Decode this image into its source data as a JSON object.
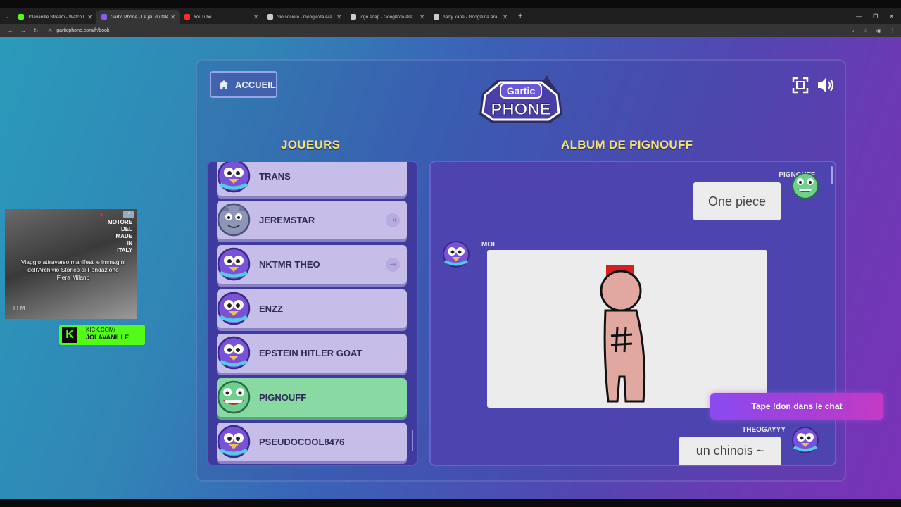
{
  "browser": {
    "tabs": [
      {
        "title": "Jolavanille Stream - Watch Live",
        "color": "#53fc18",
        "active": false
      },
      {
        "title": "Gartic Phone - Le jeu du télép…",
        "color": "#8a5cf0",
        "active": true
      },
      {
        "title": "YouTube",
        "color": "#ff2a2a",
        "active": false
      },
      {
        "title": "clio societe - Google'da Ara",
        "color": "#cccccc",
        "active": false
      },
      {
        "title": "logo snap - Google'da Ara",
        "color": "#cccccc",
        "active": false
      },
      {
        "title": "harry kane - Google'da Ara",
        "color": "#cccccc",
        "active": false
      }
    ],
    "url": "garticphone.com/fr/book"
  },
  "header": {
    "home_label": "ACCUEIL",
    "logo_line1": "Gartic",
    "logo_line2": "PHONE"
  },
  "players": {
    "title": "JOUEURS",
    "items": [
      {
        "name": "TRANS",
        "avatar": "purple-bird",
        "exit": false,
        "selected": false
      },
      {
        "name": "JEREMSTAR",
        "avatar": "grey-wolf",
        "exit": true,
        "selected": false
      },
      {
        "name": "NKTMR THEO",
        "avatar": "purple-bird",
        "exit": true,
        "selected": false
      },
      {
        "name": "ENZZ",
        "avatar": "purple-bird",
        "exit": false,
        "selected": false
      },
      {
        "name": "EPSTEIN HITLER GOAT",
        "avatar": "purple-bird",
        "exit": false,
        "selected": false
      },
      {
        "name": "PIGNOUFF",
        "avatar": "green-monster",
        "exit": false,
        "selected": true
      },
      {
        "name": "PSEUDOCOOL8476",
        "avatar": "purple-bird",
        "exit": false,
        "selected": false
      }
    ]
  },
  "album": {
    "title": "ALBUM DE PIGNOUFF",
    "messages": [
      {
        "author": "PIGNOUFF",
        "text": "One piece"
      },
      {
        "author": "MOI",
        "text": ""
      },
      {
        "author": "THEOGAYYY",
        "text": "un chinois ~"
      }
    ]
  },
  "overlay": {
    "promo": "Tape !don dans le chat",
    "ad_brand": "MOTORE\nDEL\nMADE\nIN\nITALY",
    "ad_text": "Viaggio attraverso manifesti e immagini dell'Archivio Storico di Fondazione Fiera Milano",
    "ad_footer": "FFM",
    "kick_line1": "KICK.COM/",
    "kick_line2": "JOLAVANILLE"
  }
}
